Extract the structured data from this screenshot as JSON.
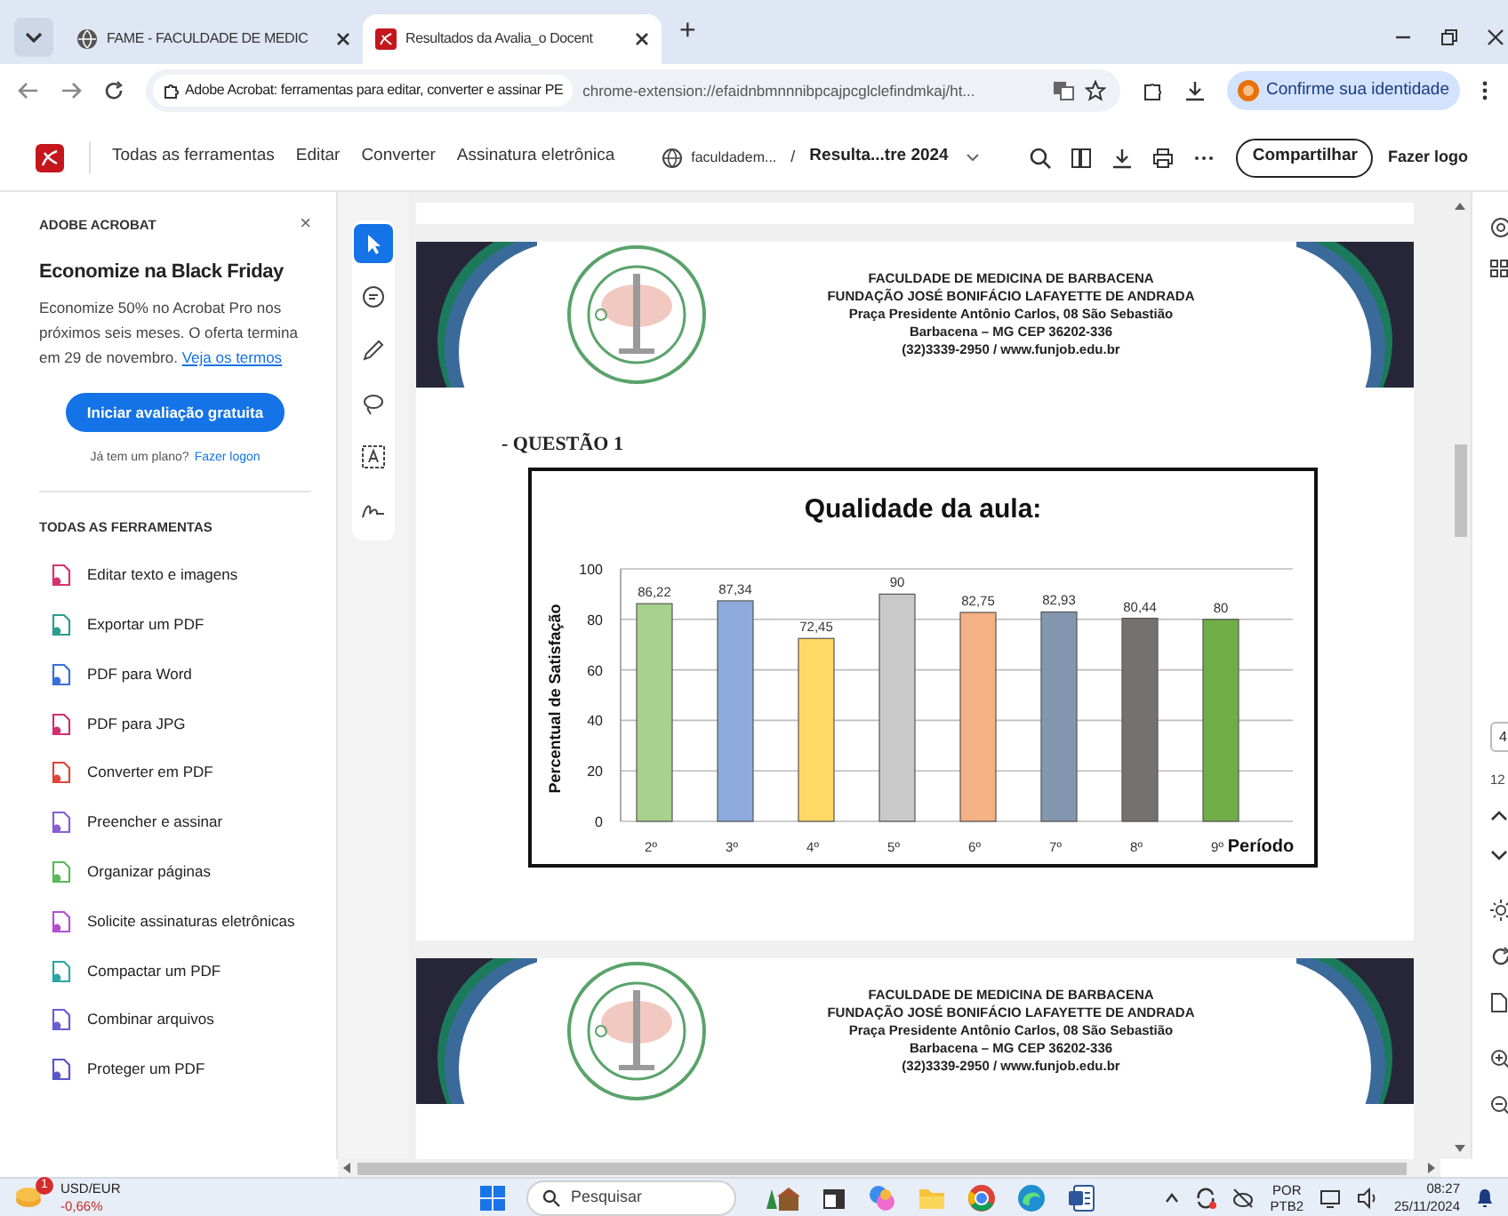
{
  "browser": {
    "tabs": [
      {
        "title": "FAME - FACULDADE DE MEDIC",
        "selected": false
      },
      {
        "title": "Resultados da Avalia_o Docent",
        "selected": true
      }
    ],
    "new_tab": "+",
    "site_chip": "Adobe Acrobat: ferramentas para editar, converter e assinar PE",
    "url": "chrome-extension://efaidnbmnnnibpcajpcglclefindmkaj/ht...",
    "profile_button": "Confirme sua identidade"
  },
  "acrobat_toolbar": {
    "menu": [
      "Todas as ferramentas",
      "Editar",
      "Converter",
      "Assinatura eletrônica"
    ],
    "folder": "faculdadem...",
    "separator": "/",
    "file_name": "Resulta...tre 2024",
    "share_button": "Compartilhar",
    "login_link": "Fazer logo"
  },
  "side_panel": {
    "heading": "ADOBE ACROBAT",
    "close": "×",
    "promo_title": "Economize na Black Friday",
    "promo_text": "Economize 50% no Acrobat Pro nos próximos seis meses. O oferta termina em 29 de novembro.",
    "terms_link": "Veja os termos",
    "trial_button": "Iniciar avaliação gratuita",
    "plan_question": "Já tem um plano?",
    "login_link": "Fazer logon",
    "tools_heading": "TODAS AS FERRAMENTAS",
    "tools": [
      {
        "label": "Editar texto e imagens",
        "color": "#d6336c"
      },
      {
        "label": "Exportar um PDF",
        "color": "#2a9d8f"
      },
      {
        "label": "PDF para Word",
        "color": "#3b6fd8"
      },
      {
        "label": "PDF para JPG",
        "color": "#d0306f"
      },
      {
        "label": "Converter em PDF",
        "color": "#e0443a"
      },
      {
        "label": "Preencher e assinar",
        "color": "#8a5cd6"
      },
      {
        "label": "Organizar páginas",
        "color": "#5bb85b"
      },
      {
        "label": "Solicite assinaturas eletrônicas",
        "color": "#b24fd1"
      },
      {
        "label": "Compactar um PDF",
        "color": "#2aa6a6"
      },
      {
        "label": "Combinar arquivos",
        "color": "#6a5cd6"
      },
      {
        "label": "Proteger um PDF",
        "color": "#5a55c8"
      }
    ]
  },
  "annotation_tools": [
    {
      "selected": true
    },
    {
      "selected": false
    },
    {
      "selected": false
    },
    {
      "selected": false
    },
    {
      "selected": false
    },
    {
      "selected": false
    }
  ],
  "document": {
    "pages": [
      {
        "header": [
          "FACULDADE DE MEDICINA DE BARBACENA",
          "FUNDAÇÃO JOSÉ BONIFÁCIO LAFAYETTE DE ANDRADA",
          "Praça Presidente Antônio Carlos, 08 São Sebastião",
          "Barbacena – MG  CEP 36202-336",
          "(32)3339-2950 / www.funjob.edu.br"
        ],
        "question": "- QUESTÃO 1",
        "chart_data": {
          "type": "bar",
          "title": "Qualidade da aula:",
          "xlabel": "Período",
          "ylabel": "Percentual de Satisfação",
          "categories": [
            "2º",
            "3º",
            "4º",
            "5º",
            "6º",
            "7º",
            "8º",
            "9º"
          ],
          "series": [
            {
              "values": [
                86.22,
                87.34,
                72.45,
                90,
                82.75,
                82.93,
                80.44,
                80
              ]
            }
          ],
          "value_labels": [
            "86,22",
            "87,34",
            "72,45",
            "90",
            "82,75",
            "82,93",
            "80,44",
            "80"
          ],
          "ylim": [
            0,
            100
          ],
          "yticks": [
            0,
            20,
            40,
            60,
            80,
            100
          ],
          "grid": true
        }
      },
      {
        "header": [
          "FACULDADE DE MEDICINA DE BARBACENA",
          "FUNDAÇÃO JOSÉ BONIFÁCIO LAFAYETTE DE ANDRADA",
          "Praça Presidente Antônio Carlos, 08 São Sebastião",
          "Barbacena – MG  CEP 36202-336",
          "(32)3339-2950 / www.funjob.edu.br"
        ]
      }
    ]
  },
  "page_nav": {
    "current": "4",
    "total": "12"
  },
  "taskbar": {
    "widget_title": "USD/EUR",
    "widget_change": "-0,66%",
    "widget_badge": "1",
    "search": "Pesquisar",
    "language": "POR",
    "layout": "PTB2",
    "time": "08:27",
    "date": "25/11/2024"
  }
}
